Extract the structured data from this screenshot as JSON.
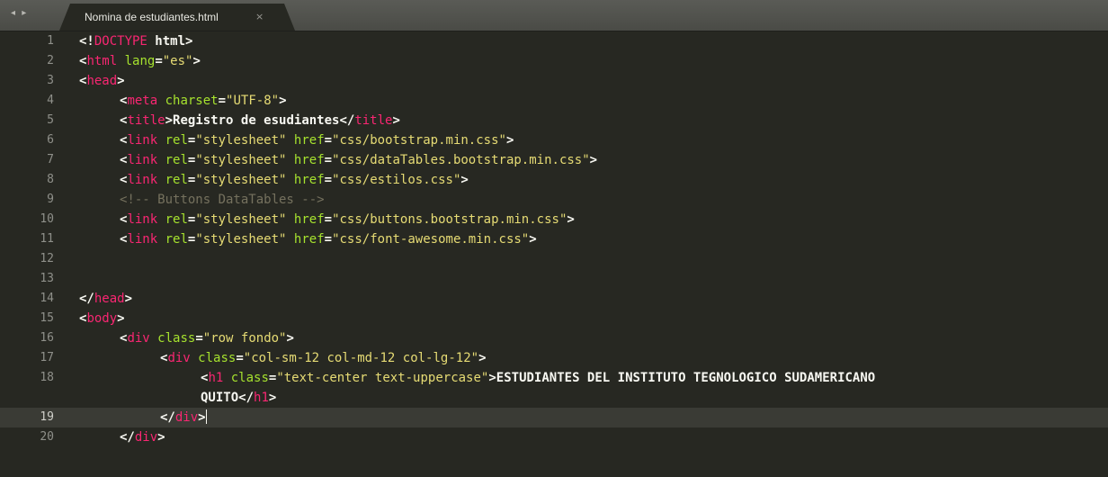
{
  "tab": {
    "title": "Nomina de estudiantes.html",
    "close": "×",
    "nav_arrows": "◂ ▸"
  },
  "lines": [
    {
      "n": "1",
      "indent": 0,
      "tokens": [
        [
          "punct",
          "<!"
        ],
        [
          "doctype",
          "DOCTYPE"
        ],
        [
          "text",
          " html"
        ],
        [
          "punct",
          ">"
        ]
      ]
    },
    {
      "n": "2",
      "indent": 0,
      "tokens": [
        [
          "punct",
          "<"
        ],
        [
          "tag",
          "html"
        ],
        [
          "text",
          " "
        ],
        [
          "attr",
          "lang"
        ],
        [
          "punct",
          "="
        ],
        [
          "str",
          "\"es\""
        ],
        [
          "punct",
          ">"
        ]
      ]
    },
    {
      "n": "3",
      "indent": 0,
      "tokens": [
        [
          "punct",
          "<"
        ],
        [
          "tag",
          "head"
        ],
        [
          "punct",
          ">"
        ]
      ]
    },
    {
      "n": "4",
      "indent": 1,
      "tokens": [
        [
          "punct",
          "<"
        ],
        [
          "tag",
          "meta"
        ],
        [
          "text",
          " "
        ],
        [
          "attr",
          "charset"
        ],
        [
          "punct",
          "="
        ],
        [
          "str",
          "\"UTF-8\""
        ],
        [
          "punct",
          ">"
        ]
      ]
    },
    {
      "n": "5",
      "indent": 1,
      "tokens": [
        [
          "punct",
          "<"
        ],
        [
          "tag",
          "title"
        ],
        [
          "punct",
          ">"
        ],
        [
          "text",
          "Registro de esudiantes"
        ],
        [
          "punct",
          "</"
        ],
        [
          "tag",
          "title"
        ],
        [
          "punct",
          ">"
        ]
      ]
    },
    {
      "n": "6",
      "indent": 1,
      "tokens": [
        [
          "punct",
          "<"
        ],
        [
          "tag",
          "link"
        ],
        [
          "text",
          " "
        ],
        [
          "attr",
          "rel"
        ],
        [
          "punct",
          "="
        ],
        [
          "str",
          "\"stylesheet\""
        ],
        [
          "text",
          " "
        ],
        [
          "attr",
          "href"
        ],
        [
          "punct",
          "="
        ],
        [
          "str",
          "\"css/bootstrap.min.css\""
        ],
        [
          "punct",
          ">"
        ]
      ]
    },
    {
      "n": "7",
      "indent": 1,
      "tokens": [
        [
          "punct",
          "<"
        ],
        [
          "tag",
          "link"
        ],
        [
          "text",
          " "
        ],
        [
          "attr",
          "rel"
        ],
        [
          "punct",
          "="
        ],
        [
          "str",
          "\"stylesheet\""
        ],
        [
          "text",
          " "
        ],
        [
          "attr",
          "href"
        ],
        [
          "punct",
          "="
        ],
        [
          "str",
          "\"css/dataTables.bootstrap.min.css\""
        ],
        [
          "punct",
          ">"
        ]
      ]
    },
    {
      "n": "8",
      "indent": 1,
      "tokens": [
        [
          "punct",
          "<"
        ],
        [
          "tag",
          "link"
        ],
        [
          "text",
          " "
        ],
        [
          "attr",
          "rel"
        ],
        [
          "punct",
          "="
        ],
        [
          "str",
          "\"stylesheet\""
        ],
        [
          "text",
          " "
        ],
        [
          "attr",
          "href"
        ],
        [
          "punct",
          "="
        ],
        [
          "str",
          "\"css/estilos.css\""
        ],
        [
          "punct",
          ">"
        ]
      ]
    },
    {
      "n": "9",
      "indent": 1,
      "tokens": [
        [
          "comment",
          "<!-- Buttons DataTables -->"
        ]
      ]
    },
    {
      "n": "10",
      "indent": 1,
      "tokens": [
        [
          "punct",
          "<"
        ],
        [
          "tag",
          "link"
        ],
        [
          "text",
          " "
        ],
        [
          "attr",
          "rel"
        ],
        [
          "punct",
          "="
        ],
        [
          "str",
          "\"stylesheet\""
        ],
        [
          "text",
          " "
        ],
        [
          "attr",
          "href"
        ],
        [
          "punct",
          "="
        ],
        [
          "str",
          "\"css/buttons.bootstrap.min.css\""
        ],
        [
          "punct",
          ">"
        ]
      ]
    },
    {
      "n": "11",
      "indent": 1,
      "tokens": [
        [
          "punct",
          "<"
        ],
        [
          "tag",
          "link"
        ],
        [
          "text",
          " "
        ],
        [
          "attr",
          "rel"
        ],
        [
          "punct",
          "="
        ],
        [
          "str",
          "\"stylesheet\""
        ],
        [
          "text",
          " "
        ],
        [
          "attr",
          "href"
        ],
        [
          "punct",
          "="
        ],
        [
          "str",
          "\"css/font-awesome.min.css\""
        ],
        [
          "punct",
          ">"
        ]
      ]
    },
    {
      "n": "12",
      "indent": 0,
      "tokens": []
    },
    {
      "n": "13",
      "indent": 0,
      "tokens": []
    },
    {
      "n": "14",
      "indent": 0,
      "tokens": [
        [
          "punct",
          "</"
        ],
        [
          "tag",
          "head"
        ],
        [
          "punct",
          ">"
        ]
      ]
    },
    {
      "n": "15",
      "indent": 0,
      "tokens": [
        [
          "punct",
          "<"
        ],
        [
          "tag",
          "body"
        ],
        [
          "punct",
          ">"
        ]
      ]
    },
    {
      "n": "16",
      "indent": 1,
      "tokens": [
        [
          "punct",
          "<"
        ],
        [
          "tag",
          "div"
        ],
        [
          "text",
          " "
        ],
        [
          "attr",
          "class"
        ],
        [
          "punct",
          "="
        ],
        [
          "str",
          "\"row fondo\""
        ],
        [
          "punct",
          ">"
        ]
      ]
    },
    {
      "n": "17",
      "indent": 2,
      "tokens": [
        [
          "punct",
          "<"
        ],
        [
          "tag",
          "div"
        ],
        [
          "text",
          " "
        ],
        [
          "attr",
          "class"
        ],
        [
          "punct",
          "="
        ],
        [
          "str",
          "\"col-sm-12 col-md-12 col-lg-12\""
        ],
        [
          "punct",
          ">"
        ]
      ]
    },
    {
      "n": "18",
      "indent": 3,
      "tokens": [
        [
          "punct",
          "<"
        ],
        [
          "tag",
          "h1"
        ],
        [
          "text",
          " "
        ],
        [
          "attr",
          "class"
        ],
        [
          "punct",
          "="
        ],
        [
          "str",
          "\"text-center text-uppercase\""
        ],
        [
          "punct",
          ">"
        ],
        [
          "text",
          "ESTUDIANTES DEL INSTITUTO TEGNOLOGICO SUDAMERICANO"
        ]
      ]
    },
    {
      "n": "",
      "indent": 3,
      "tokens": [
        [
          "text",
          "QUITO"
        ],
        [
          "punct",
          "</"
        ],
        [
          "tag",
          "h1"
        ],
        [
          "punct",
          ">"
        ]
      ]
    },
    {
      "n": "19",
      "indent": 2,
      "active": true,
      "tokens": [
        [
          "punct",
          "</"
        ],
        [
          "tag",
          "div"
        ],
        [
          "punct",
          ">"
        ],
        [
          "cursor",
          ""
        ]
      ]
    },
    {
      "n": "20",
      "indent": 1,
      "tokens": [
        [
          "punct",
          "</"
        ],
        [
          "tag",
          "div"
        ],
        [
          "punct",
          ">"
        ]
      ]
    }
  ]
}
